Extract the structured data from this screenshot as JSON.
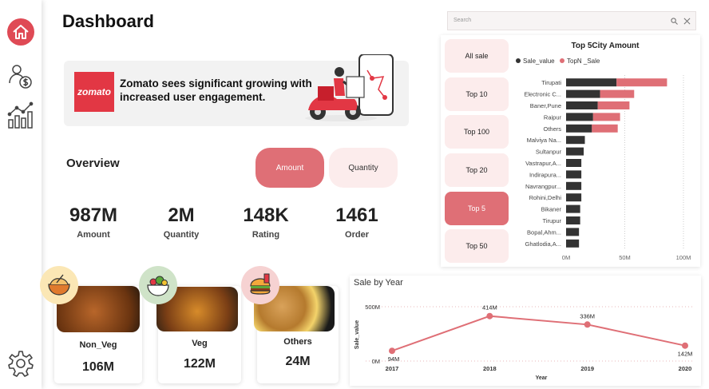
{
  "header": {
    "title": "Dashboard"
  },
  "sidebar": {
    "items": [
      "home-icon",
      "sales-money-icon",
      "analytics-chart-icon",
      "settings-gear-icon"
    ]
  },
  "banner": {
    "logo_text": "zomato",
    "text": "Zomato sees significant growing with increased user engagement."
  },
  "overview": {
    "title": "Overview",
    "toggle": {
      "amount_label": "Amount",
      "quantity_label": "Quantity",
      "selected": "Amount"
    }
  },
  "kpis": [
    {
      "value": "987M",
      "label": "Amount"
    },
    {
      "value": "2M",
      "label": "Quantity"
    },
    {
      "value": "148K",
      "label": "Rating"
    },
    {
      "value": "1461",
      "label": "Order"
    }
  ],
  "food_cards": [
    {
      "name": "Non_Veg",
      "value": "106M",
      "icon": "biryani-icon"
    },
    {
      "name": "Veg",
      "value": "122M",
      "icon": "salad-icon"
    },
    {
      "name": "Others",
      "value": "24M",
      "icon": "fastfood-icon"
    }
  ],
  "search": {
    "placeholder": "Search"
  },
  "slicer": {
    "items": [
      "All sale",
      "Top 10",
      "Top 100",
      "Top 20",
      "Top 5",
      "Top 50"
    ],
    "selected": "Top 5"
  },
  "colors": {
    "accent": "#df6f76",
    "dark_bar": "#333333",
    "light_pink": "#fcecec"
  },
  "chart_data": [
    {
      "type": "bar",
      "orientation": "horizontal",
      "stacked": true,
      "title": "Top 5City Amount",
      "legend": [
        "Sale_value",
        "TopN _Sale"
      ],
      "legend_position": "top-left",
      "categories": [
        "Tirupati",
        "Electronic C...",
        "Baner,Pune",
        "Raipur",
        "Others",
        "Malviya Na...",
        "Sultanpur",
        "Vastrapur,A...",
        "Indirapura...",
        "Navrangpur...",
        "Rohini,Delhi",
        "Bikaner",
        "Tirupur",
        "Bopal,Ahm...",
        "Ghatlodia,A..."
      ],
      "series": [
        {
          "name": "Sale_value",
          "values": [
            43,
            29,
            27,
            23,
            22,
            16,
            15,
            13,
            13,
            13,
            13,
            12,
            12,
            11,
            11
          ]
        },
        {
          "name": "TopN _Sale",
          "values": [
            43,
            29,
            27,
            23,
            22,
            0,
            0,
            0,
            0,
            0,
            0,
            0,
            0,
            0,
            0
          ]
        }
      ],
      "x_ticks": [
        "0M",
        "50M",
        "100M"
      ],
      "xlim": [
        0,
        100
      ]
    },
    {
      "type": "line",
      "title": "Sale by Year",
      "xlabel": "Year",
      "ylabel": "Sale_value",
      "x": [
        "2017",
        "2018",
        "2019",
        "2020"
      ],
      "values": [
        94,
        414,
        336,
        142
      ],
      "data_labels": [
        "94M",
        "414M",
        "336M",
        "142M"
      ],
      "y_ticks": [
        "0M",
        "500M"
      ],
      "ylim": [
        0,
        500
      ]
    }
  ]
}
